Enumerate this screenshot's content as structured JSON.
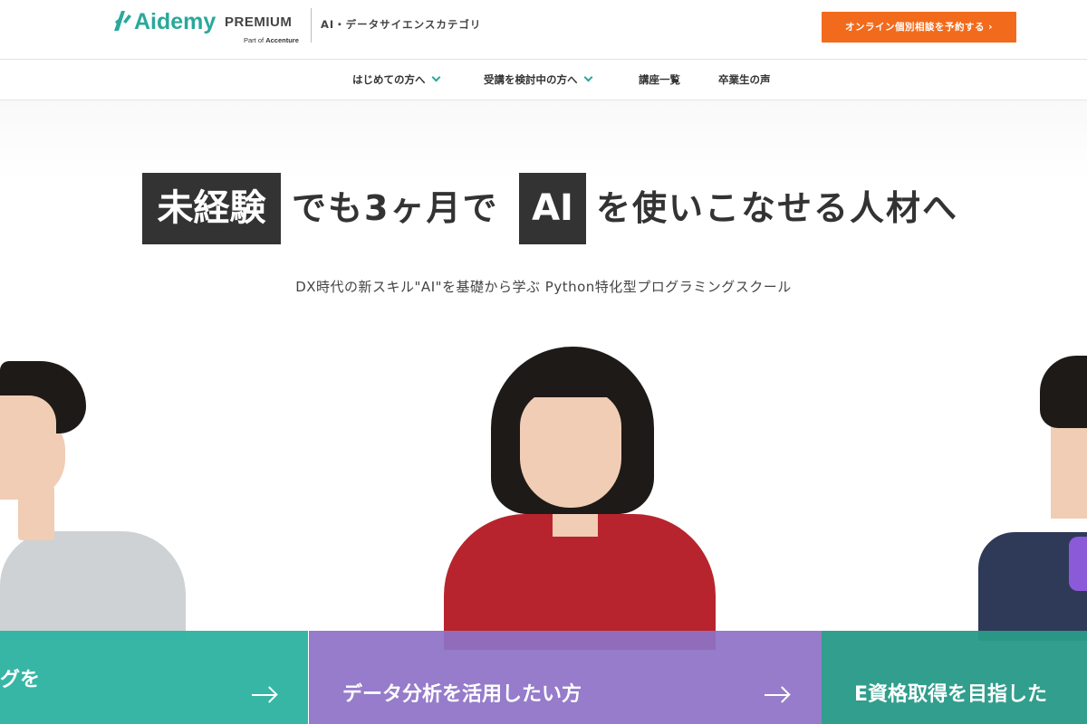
{
  "header": {
    "brand": "Aidemy",
    "brand_suffix": "PREMIUM",
    "part_of_prefix": "Part of",
    "part_of_company": "Accenture",
    "category": "AI・データサイエンスカテゴリ",
    "cta_label": "オンライン個別相談を予約する ›",
    "brand_color": "#2aa89a",
    "cta_color": "#f26b1d"
  },
  "nav": {
    "items": [
      {
        "label": "はじめての方へ",
        "dropdown": true
      },
      {
        "label": "受講を検討中の方へ",
        "dropdown": true
      },
      {
        "label": "講座一覧",
        "dropdown": false
      },
      {
        "label": "卒業生の声",
        "dropdown": false
      }
    ]
  },
  "hero": {
    "headline": {
      "box1": "未経験",
      "text1": "でも3ヶ月で",
      "box2": "AI",
      "text2": "を使いこなせる人材へ"
    },
    "subtitle": "DX時代の新スキル\"AI\"を基礎から学ぶ Python特化型プログラミングスクール"
  },
  "cards": [
    {
      "title": "グを",
      "color": "#2fb3a2"
    },
    {
      "title": "データ分析を活用したい方",
      "color": "#8e72c6"
    },
    {
      "title": "E資格取得を目指した",
      "color": "#2a9a88"
    }
  ]
}
